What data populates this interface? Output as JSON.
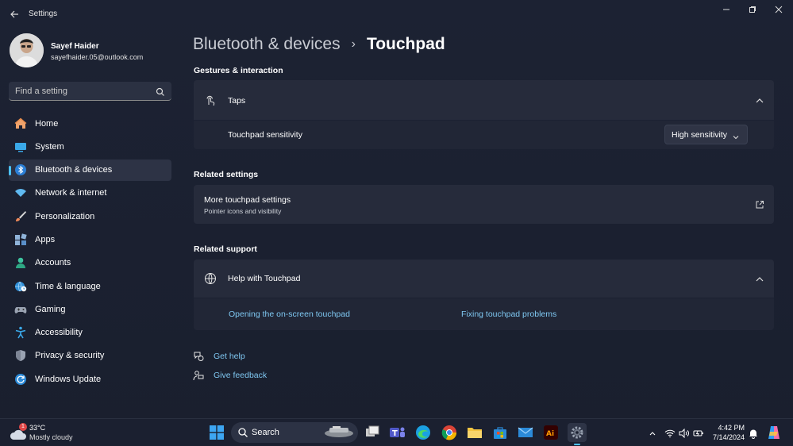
{
  "app": {
    "title": "Settings"
  },
  "profile": {
    "name": "Sayef Haider",
    "email": "sayefhaider.05@outlook.com"
  },
  "search": {
    "placeholder": "Find a setting"
  },
  "sidebar": {
    "items": [
      {
        "label": "Home",
        "icon": "home-icon"
      },
      {
        "label": "System",
        "icon": "system-icon"
      },
      {
        "label": "Bluetooth & devices",
        "icon": "bluetooth-icon",
        "active": true
      },
      {
        "label": "Network & internet",
        "icon": "wifi-icon"
      },
      {
        "label": "Personalization",
        "icon": "brush-icon"
      },
      {
        "label": "Apps",
        "icon": "apps-icon"
      },
      {
        "label": "Accounts",
        "icon": "person-icon"
      },
      {
        "label": "Time & language",
        "icon": "globe-clock-icon"
      },
      {
        "label": "Gaming",
        "icon": "gamepad-icon"
      },
      {
        "label": "Accessibility",
        "icon": "accessibility-icon"
      },
      {
        "label": "Privacy & security",
        "icon": "shield-icon"
      },
      {
        "label": "Windows Update",
        "icon": "update-icon"
      }
    ]
  },
  "breadcrumb": {
    "parent": "Bluetooth & devices",
    "separator": "›",
    "current": "Touchpad"
  },
  "gestures": {
    "heading": "Gestures & interaction",
    "taps_label": "Taps",
    "sensitivity_label": "Touchpad sensitivity",
    "sensitivity_value": "High sensitivity"
  },
  "related_settings": {
    "heading": "Related settings",
    "title": "More touchpad settings",
    "subtitle": "Pointer icons and visibility"
  },
  "related_support": {
    "heading": "Related support",
    "help_label": "Help with Touchpad",
    "links": [
      "Opening the on-screen touchpad",
      "Fixing touchpad problems"
    ]
  },
  "footer_links": {
    "get_help": "Get help",
    "give_feedback": "Give feedback"
  },
  "taskbar": {
    "weather_temp": "33°C",
    "weather_desc": "Mostly cloudy",
    "weather_badge": "1",
    "search_label": "Search",
    "time": "4:42 PM",
    "date": "7/14/2024"
  },
  "colors": {
    "accent": "#4cc2ff",
    "link": "#7fc8f2",
    "background": "#1c2233",
    "card": "#262b3b"
  }
}
